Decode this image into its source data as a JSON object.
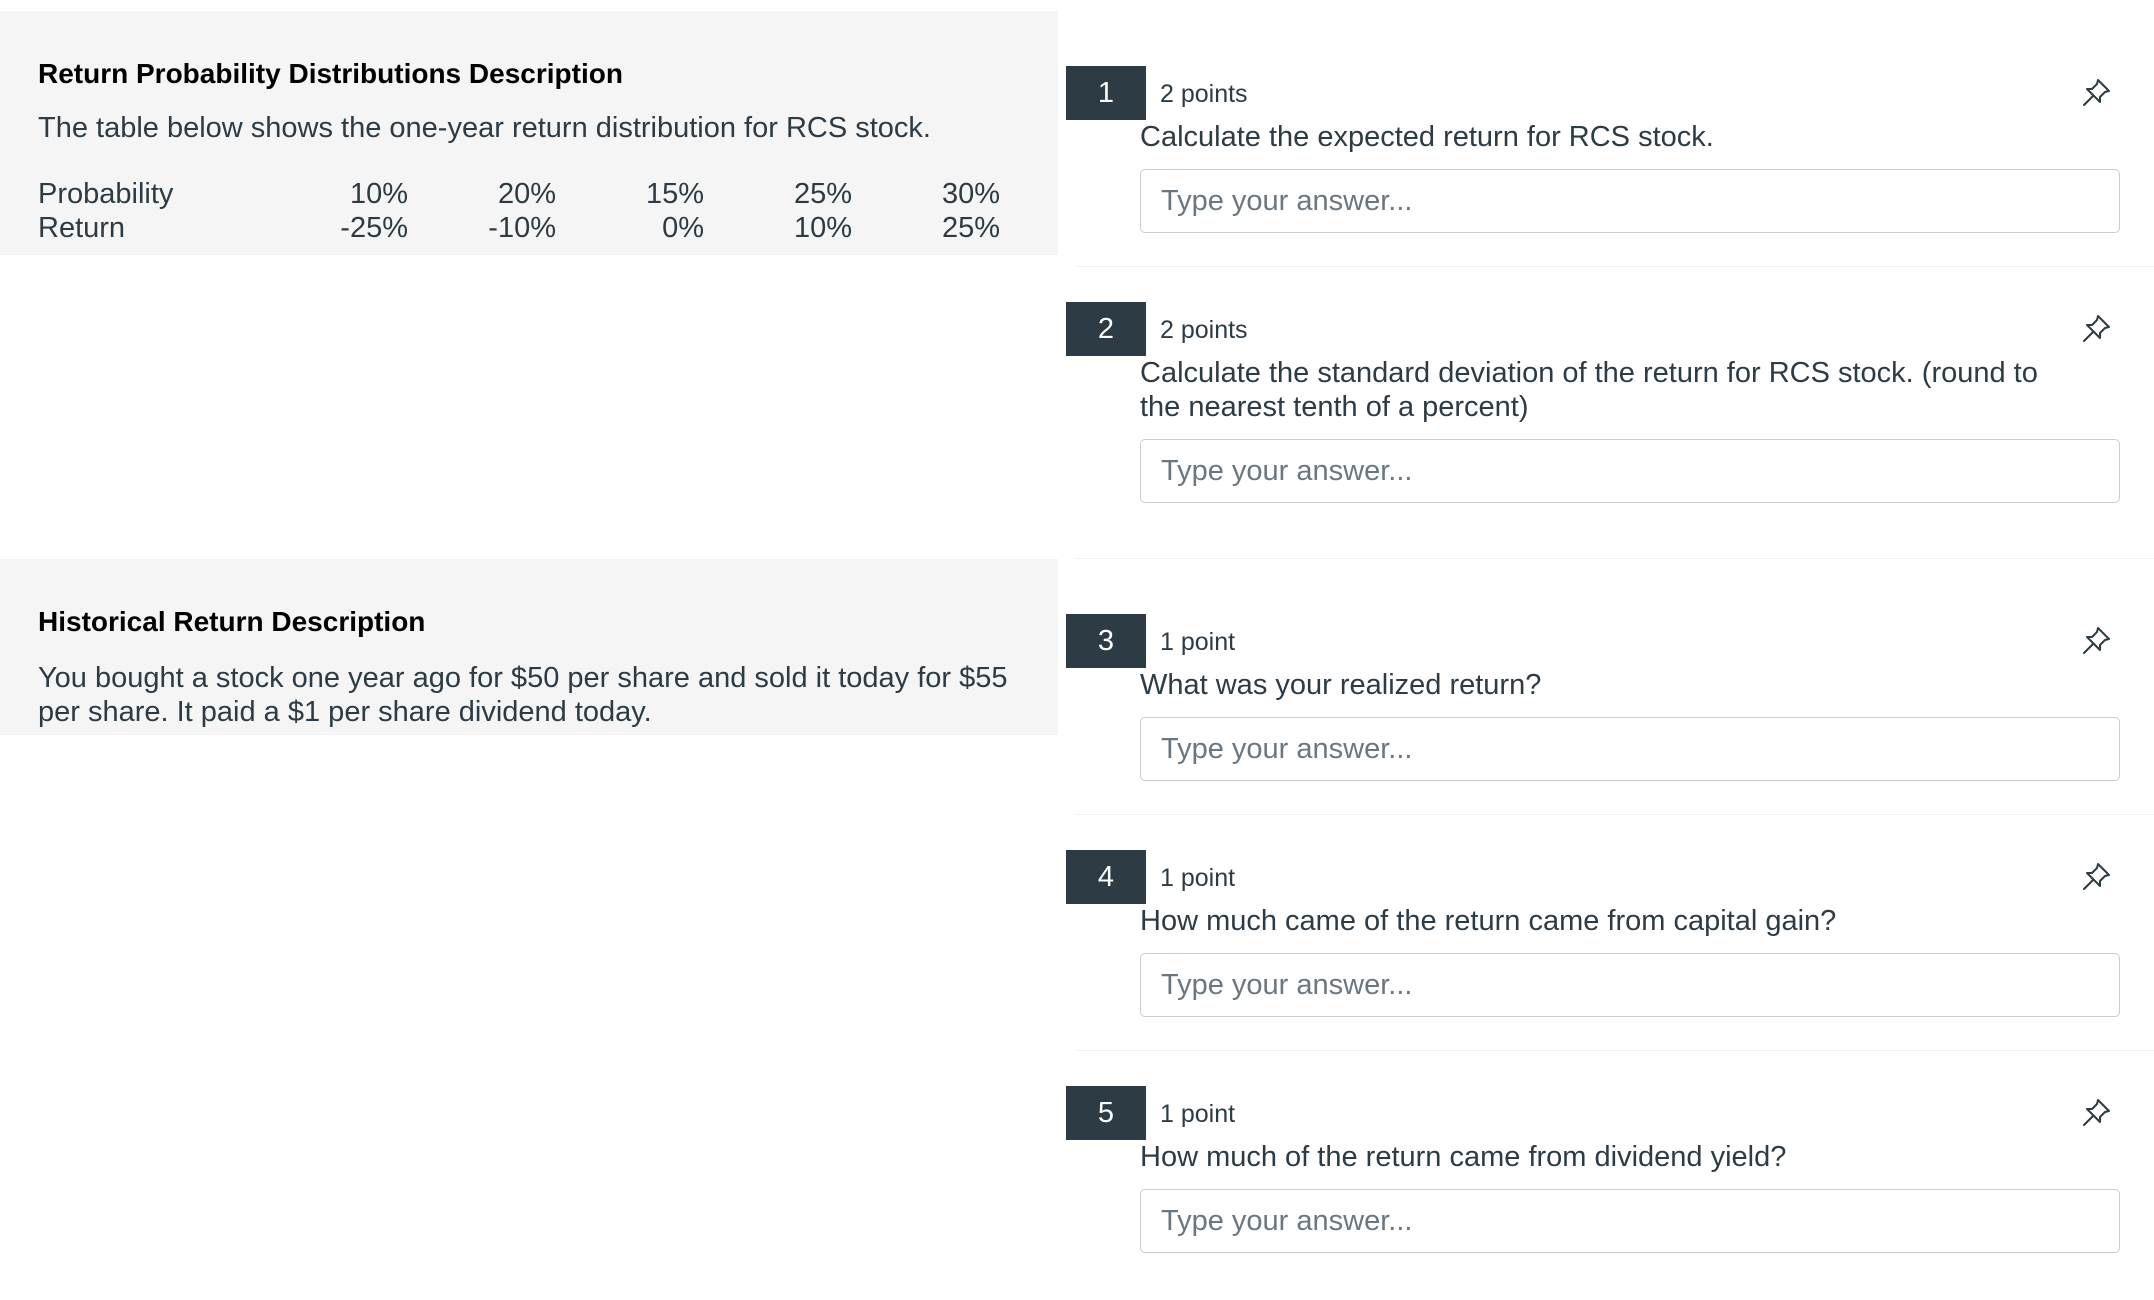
{
  "stimuli": [
    {
      "title": "Return Probability Distributions Description",
      "text": "The table below shows the one-year return distribution for RCS stock.",
      "table": {
        "rows": [
          {
            "label": "Probability",
            "values": [
              "10%",
              "20%",
              "15%",
              "25%",
              "30%"
            ]
          },
          {
            "label": "Return",
            "values": [
              "-25%",
              "-10%",
              "0%",
              "10%",
              "25%"
            ]
          }
        ]
      }
    },
    {
      "title": "Historical Return Description",
      "text": "You bought a stock one year ago for $50 per share and sold it today for $55 per share. It paid a $1 per share dividend today."
    }
  ],
  "questions": [
    {
      "number": "1",
      "points": "2 points",
      "text": "Calculate the expected return for RCS stock.",
      "placeholder": "Type your answer...",
      "pin_icon": "pin-icon"
    },
    {
      "number": "2",
      "points": "2 points",
      "text": "Calculate the standard deviation of the return for RCS stock. (round to the nearest tenth of a percent)",
      "placeholder": "Type your answer...",
      "pin_icon": "pin-icon"
    },
    {
      "number": "3",
      "points": "1 point",
      "text": "What was your realized return?",
      "placeholder": "Type your answer...",
      "pin_icon": "pin-icon"
    },
    {
      "number": "4",
      "points": "1 point",
      "text": "How much came of the return came from capital gain?",
      "placeholder": "Type your answer...",
      "pin_icon": "pin-icon"
    },
    {
      "number": "5",
      "points": "1 point",
      "text": "How much of the return came from dividend yield?",
      "placeholder": "Type your answer...",
      "pin_icon": "pin-icon"
    }
  ],
  "colors": {
    "number_badge_bg": "#2d3b45",
    "stimulus_bg": "#f5f5f5",
    "text": "#2d3b45",
    "input_border": "#c7cdd1"
  }
}
